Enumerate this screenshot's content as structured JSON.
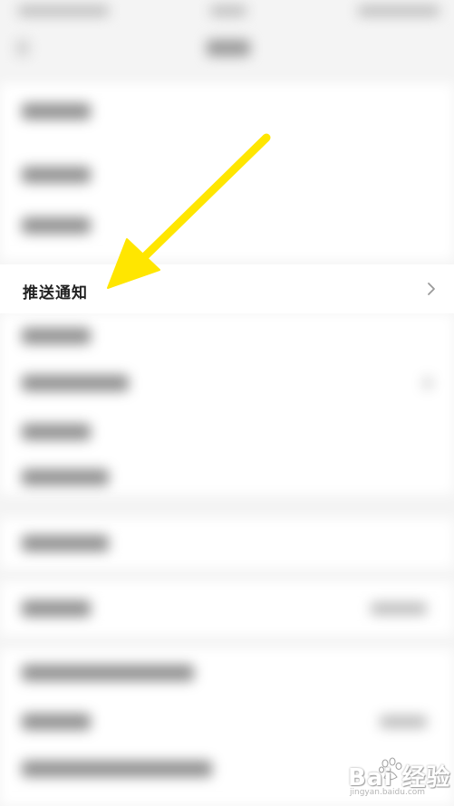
{
  "settings": {
    "push_notification_label": "推送通知"
  },
  "watermark": {
    "brand": "Bai 经验",
    "url": "jingyan.baidu.com"
  },
  "annotation": {
    "arrow_color": "#ffe600"
  },
  "icons": {
    "chevron": "chevron-right-icon",
    "paw": "baidu-paw-icon"
  }
}
